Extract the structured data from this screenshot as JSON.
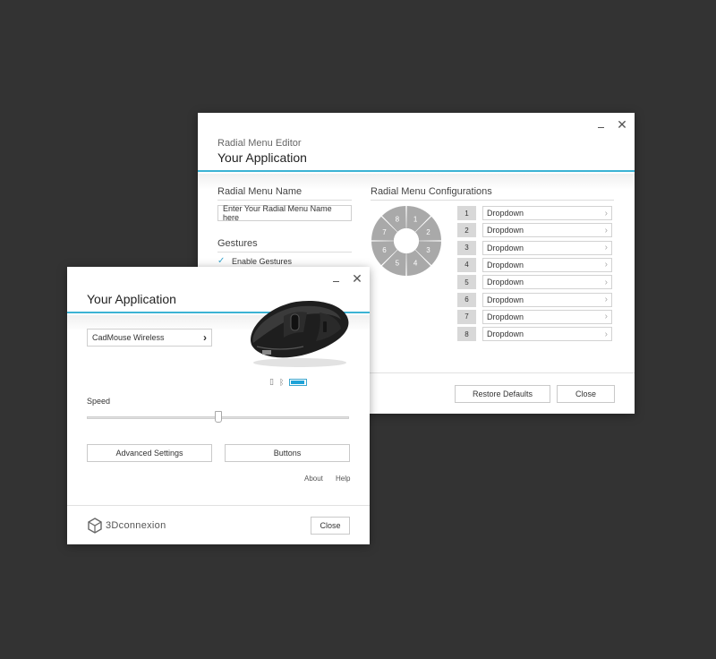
{
  "editor": {
    "subtitle": "Radial Menu Editor",
    "title": "Your Application",
    "name_section_label": "Radial Menu Name",
    "name_input_placeholder": "Enter Your Radial Menu Name here",
    "gestures_label": "Gestures",
    "enable_gestures_label": "Enable Gestures",
    "enable_gestures_checked": true,
    "configs_label": "Radial Menu Configurations",
    "wheel_segments": [
      "1",
      "2",
      "3",
      "4",
      "5",
      "6",
      "7",
      "8"
    ],
    "configs": [
      {
        "num": "1",
        "value": "Dropdown"
      },
      {
        "num": "2",
        "value": "Dropdown"
      },
      {
        "num": "3",
        "value": "Dropdown"
      },
      {
        "num": "4",
        "value": "Dropdown"
      },
      {
        "num": "5",
        "value": "Dropdown"
      },
      {
        "num": "6",
        "value": "Dropdown"
      },
      {
        "num": "7",
        "value": "Dropdown"
      },
      {
        "num": "8",
        "value": "Dropdown"
      }
    ],
    "restore_label": "Restore Defaults",
    "close_label": "Close"
  },
  "main": {
    "title": "Your Application",
    "device": "CadMouse Wireless",
    "speed_label": "Speed",
    "speed_level": 0.5,
    "battery_level": 0.9,
    "advanced_label": "Advanced Settings",
    "buttons_label": "Buttons",
    "about_label": "About",
    "help_label": "Help",
    "brand": "3Dconnexion",
    "close_label": "Close"
  },
  "colors": {
    "accent": "#3cb3d4",
    "background": "#333333",
    "wheel": "#a9a9a9"
  },
  "icons": [
    "minimize-icon",
    "close-icon",
    "checkmark-icon",
    "chevron-right-icon",
    "usb-icon",
    "bluetooth-icon",
    "battery-icon",
    "cube-logo-icon"
  ]
}
